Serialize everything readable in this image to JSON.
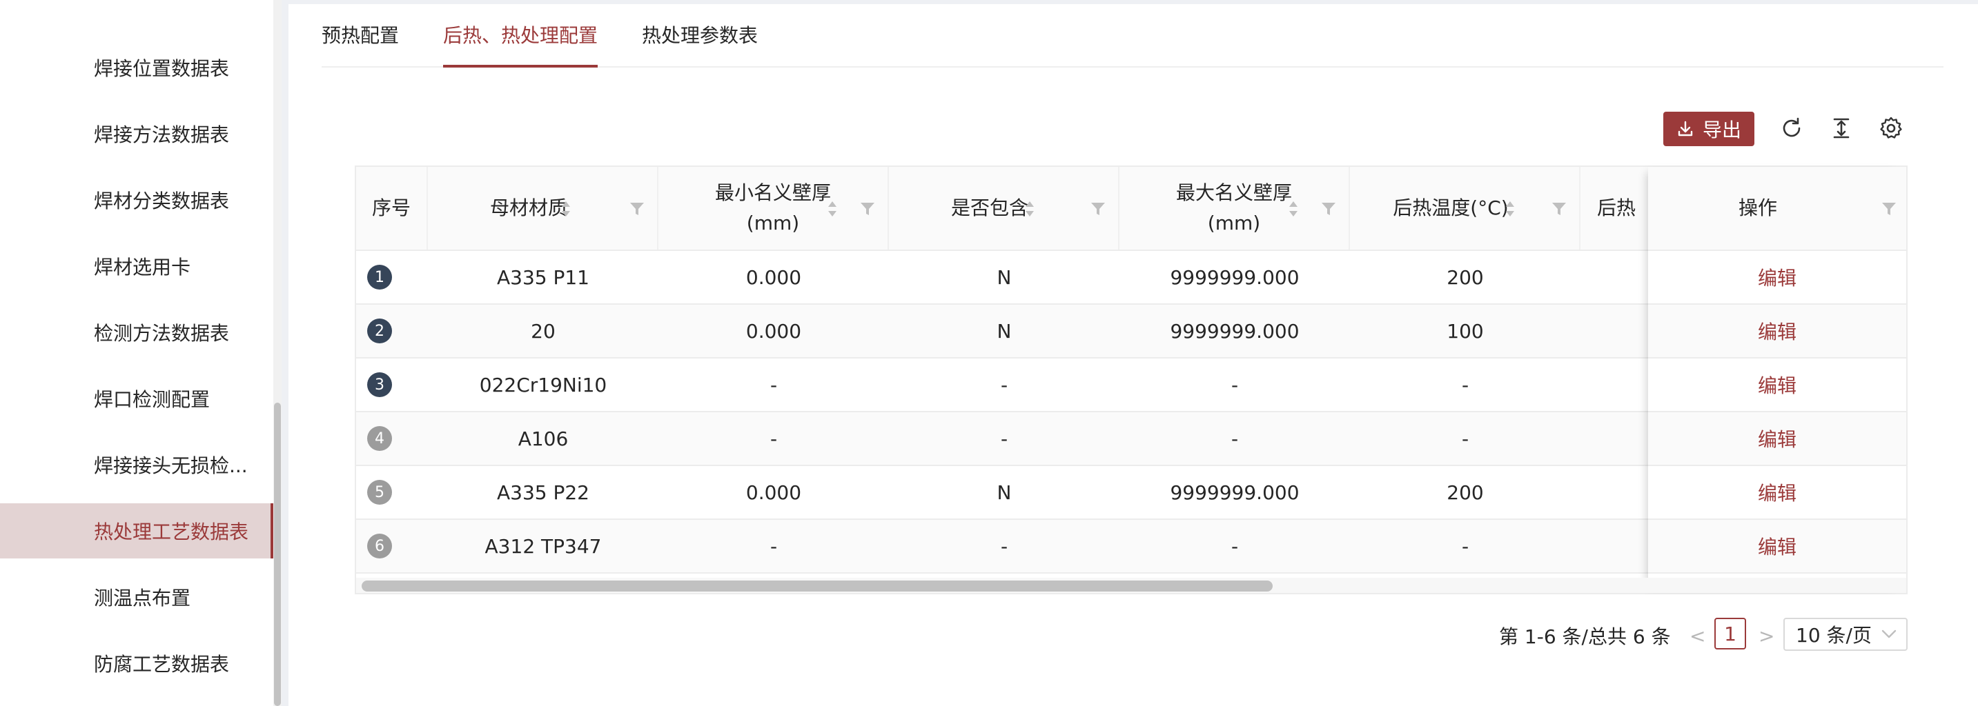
{
  "sidebar": {
    "items": [
      {
        "label": "焊接位置数据表"
      },
      {
        "label": "焊接方法数据表"
      },
      {
        "label": "焊材分类数据表"
      },
      {
        "label": "焊材选用卡"
      },
      {
        "label": "检测方法数据表"
      },
      {
        "label": "焊口检测配置"
      },
      {
        "label": "焊接接头无损检..."
      },
      {
        "label": "热处理工艺数据表",
        "active": true
      },
      {
        "label": "测温点布置"
      },
      {
        "label": "防腐工艺数据表"
      }
    ]
  },
  "tabs": [
    {
      "label": "预热配置"
    },
    {
      "label": "后热、热处理配置",
      "active": true
    },
    {
      "label": "热处理参数表"
    }
  ],
  "toolbar": {
    "export_label": "导出",
    "icons": [
      "refresh-icon",
      "column-height-icon",
      "settings-icon"
    ]
  },
  "table": {
    "columns": [
      {
        "label": "序号"
      },
      {
        "label": "母材材质"
      },
      {
        "label": "最小名义壁厚(mm)",
        "line1": "最小名义壁厚",
        "line2": "(mm)"
      },
      {
        "label": "是否包含"
      },
      {
        "label": "最大名义壁厚(mm)",
        "line1": "最大名义壁厚",
        "line2": "(mm)"
      },
      {
        "label": "后热温度(°C)"
      },
      {
        "label": "后热"
      },
      {
        "label": "操作"
      }
    ],
    "rows": [
      {
        "index": "1",
        "material": "A335 P11",
        "min_thickness": "0.000",
        "include": "N",
        "max_thickness": "9999999.000",
        "temp": "200",
        "action": "编辑"
      },
      {
        "index": "2",
        "material": "20",
        "min_thickness": "0.000",
        "include": "N",
        "max_thickness": "9999999.000",
        "temp": "100",
        "action": "编辑"
      },
      {
        "index": "3",
        "material": "022Cr19Ni10",
        "min_thickness": "-",
        "include": "-",
        "max_thickness": "-",
        "temp": "-",
        "action": "编辑"
      },
      {
        "index": "4",
        "material": "A106",
        "min_thickness": "-",
        "include": "-",
        "max_thickness": "-",
        "temp": "-",
        "action": "编辑"
      },
      {
        "index": "5",
        "material": "A335 P22",
        "min_thickness": "0.000",
        "include": "N",
        "max_thickness": "9999999.000",
        "temp": "200",
        "action": "编辑"
      },
      {
        "index": "6",
        "material": "A312 TP347",
        "min_thickness": "-",
        "include": "-",
        "max_thickness": "-",
        "temp": "-",
        "action": "编辑"
      }
    ]
  },
  "pagination": {
    "total_text": "第 1-6 条/总共 6 条",
    "prev": "<",
    "current": "1",
    "next": ">",
    "page_size": "10 条/页"
  },
  "colors": {
    "accent": "#9b3a3a",
    "badge_dark": "#364559",
    "badge_gray": "#9c9c9c"
  }
}
